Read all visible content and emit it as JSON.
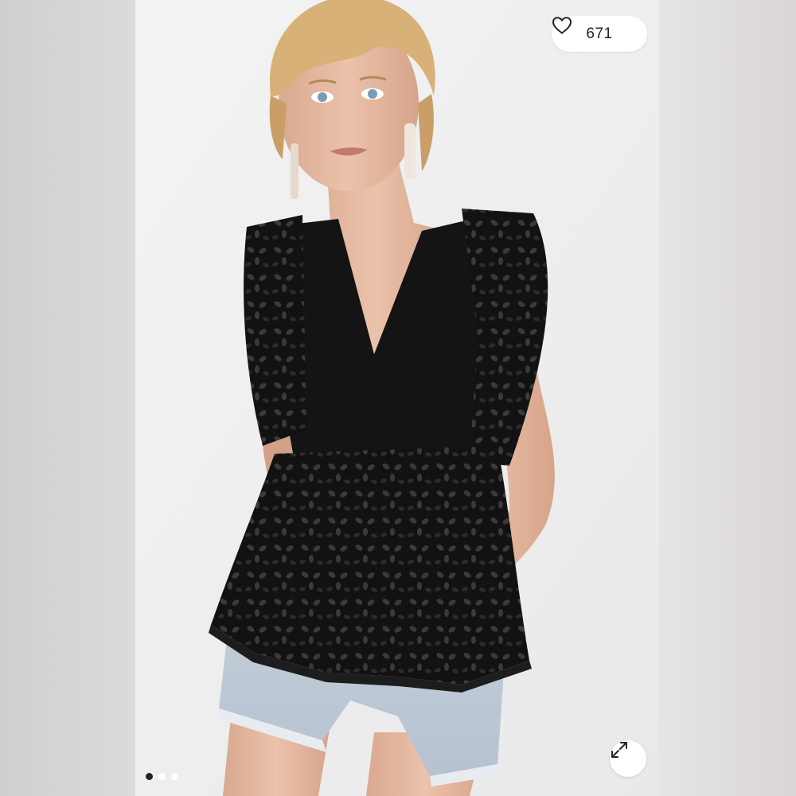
{
  "listing": {
    "likes_count": "671",
    "like_icon": "heart-outline-icon",
    "expand_icon": "expand-arrows-icon"
  },
  "carousel": {
    "total_images": 3,
    "active_index": 0
  },
  "colors": {
    "photo_bg": "#f1f1f2",
    "top_black": "#111111",
    "denim": "#c9d3de",
    "skin": "#e3b79f",
    "hair": "#d9b27a"
  }
}
